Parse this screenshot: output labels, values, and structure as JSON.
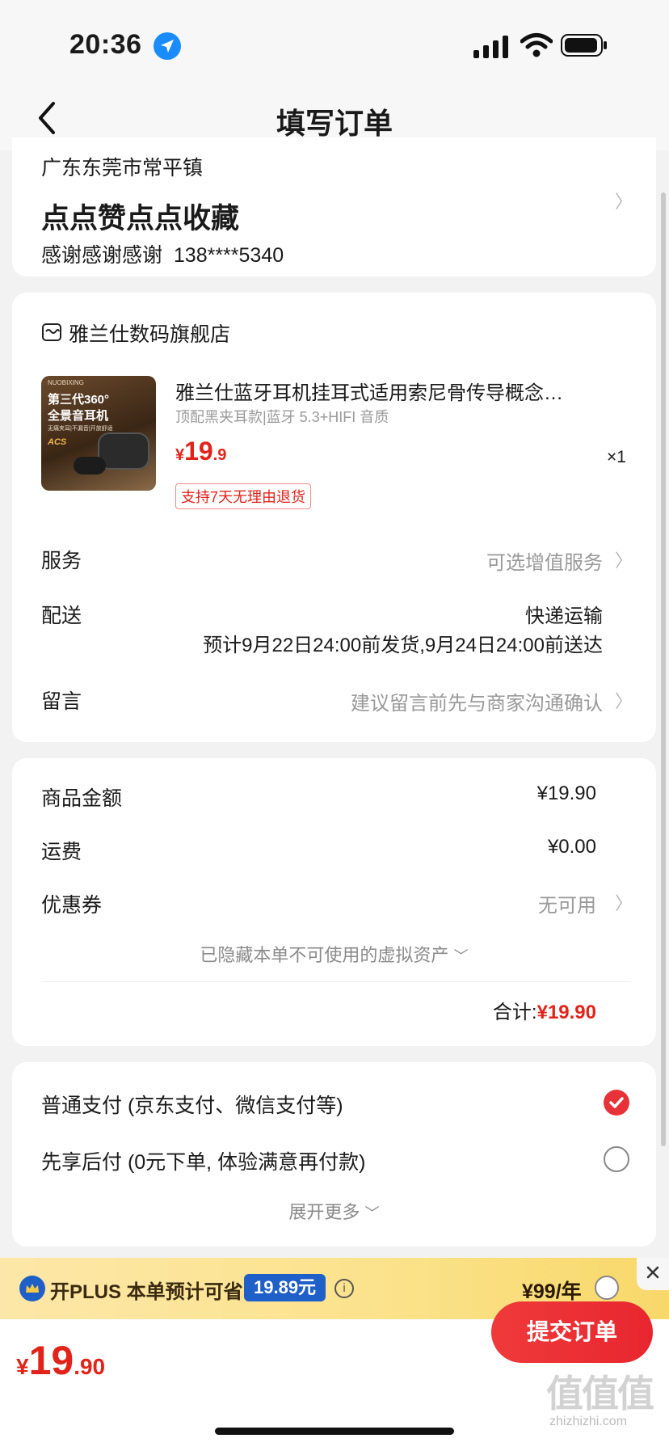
{
  "status_bar": {
    "time": "20:36"
  },
  "header": {
    "title": "填写订单"
  },
  "address": {
    "region": "广东东莞市常平镇",
    "detail": "点点赞点点收藏",
    "contact": "感谢感谢感谢  138****5340"
  },
  "store": {
    "name": "雅兰仕数码旗舰店",
    "product": {
      "title": "雅兰仕蓝牙耳机挂耳式适用索尼骨传导概念…",
      "spec": "顶配黑夹耳款|蓝牙 5.3+HIFI 音质",
      "price_symbol": "¥",
      "price_int": "19",
      "price_dec": ".9",
      "qty": "×1",
      "return_tag": "支持7天无理由退货",
      "image_texts": {
        "brand": "NUOBIXING",
        "line1": "第三代360°",
        "line2": "全景音耳机",
        "line3": "无痛夹耳|不漏音|开放舒适",
        "logo": "ACS"
      }
    },
    "rows": {
      "service_label": "服务",
      "service_value": "可选增值服务",
      "delivery_label": "配送",
      "delivery_method": "快递运输",
      "delivery_eta": "预计9月22日24:00前发货,9月24日24:00前送达",
      "note_label": "留言",
      "note_placeholder": "建议留言前先与商家沟通确认"
    }
  },
  "summary": {
    "goods_label": "商品金额",
    "goods_value": "¥19.90",
    "shipping_label": "运费",
    "shipping_value": "¥0.00",
    "coupon_label": "优惠券",
    "coupon_value": "无可用",
    "hidden_assets": "已隐藏本单不可使用的虚拟资产",
    "total_label": "合计:",
    "total_value": "¥19.90"
  },
  "payment": {
    "option1": "普通支付 (京东支付、微信支付等)",
    "option2": "先享后付 (0元下单, 体验满意再付款)",
    "expand": "展开更多"
  },
  "plus_bar": {
    "text": "开PLUS 本单预计可省",
    "saving": "19.89元",
    "price": "¥99/年"
  },
  "bottom_bar": {
    "symbol": "¥",
    "amount_int": "19",
    "amount_dec": ".90",
    "submit": "提交订单"
  },
  "watermark": {
    "brand": "值值值",
    "domain": "zhizhizhi.com"
  },
  "colors": {
    "accent": "#e8262f",
    "plus_badge": "#1f5fc8"
  }
}
